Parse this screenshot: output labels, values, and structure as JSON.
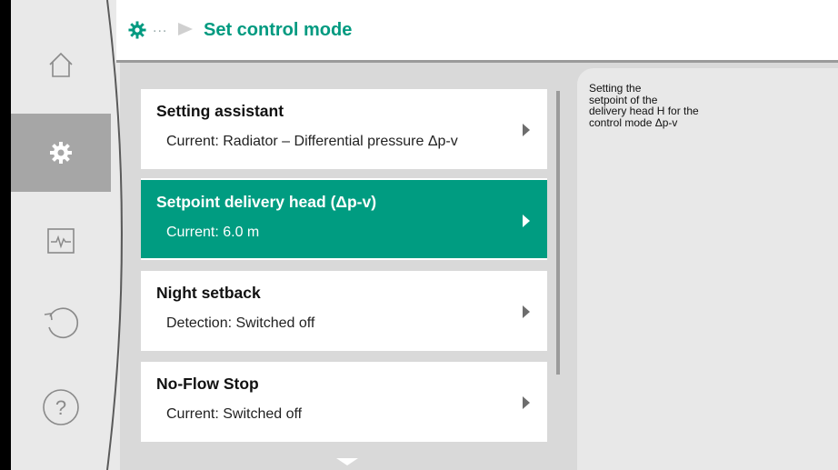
{
  "header": {
    "title": "Set control mode",
    "breadcrumb_dots": "...",
    "icon": "gear-icon"
  },
  "sidebar": {
    "items": [
      {
        "name": "home",
        "icon": "home-icon",
        "active": false
      },
      {
        "name": "settings",
        "icon": "gear-icon",
        "active": true
      },
      {
        "name": "diagnostics",
        "icon": "pulse-monitor-icon",
        "active": false
      },
      {
        "name": "undo",
        "icon": "undo-icon",
        "active": false
      },
      {
        "name": "help",
        "icon": "help-icon",
        "active": false
      }
    ]
  },
  "menu": {
    "items": [
      {
        "title": "Setting assistant",
        "subtitle": "Current: Radiator – Differential pressure Δp-v",
        "selected": false
      },
      {
        "title": "Setpoint delivery head (Δp-v)",
        "subtitle": "Current: 6.0 m",
        "selected": true
      },
      {
        "title": "Night setback",
        "subtitle": "Detection: Switched off",
        "selected": false
      },
      {
        "title": "No-Flow Stop",
        "subtitle": "Current: Switched off",
        "selected": false
      }
    ]
  },
  "help_panel": {
    "lines": [
      "Setting the",
      "setpoint of the",
      "delivery head H for the",
      "control mode Δp-v"
    ]
  },
  "colors": {
    "accent": "#009c81",
    "title_green": "#009a80"
  }
}
